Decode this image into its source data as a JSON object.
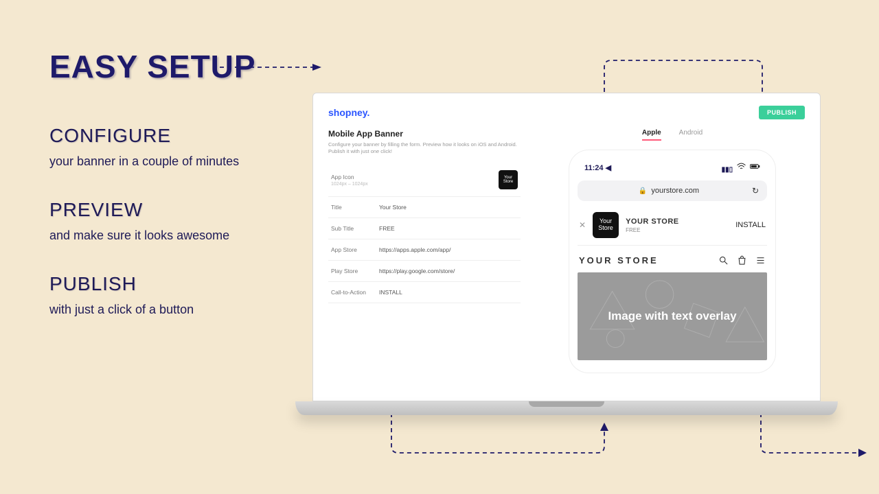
{
  "marketing": {
    "title": "EASY SETUP",
    "steps": [
      {
        "heading": "CONFIGURE",
        "desc": "your banner in a couple of minutes"
      },
      {
        "heading": "PREVIEW",
        "desc": "and make sure it looks awesome"
      },
      {
        "heading": "PUBLISH",
        "desc": "with just a click of a button"
      }
    ]
  },
  "app": {
    "brand": "shopney.",
    "publish_label": "PUBLISH",
    "config": {
      "title": "Mobile App Banner",
      "desc": "Configure your banner by filling the form. Preview how it looks on iOS and Android. Publish it with just one click!",
      "fields": {
        "app_icon": {
          "label": "App Icon",
          "helper": "1024px – 1024px",
          "value": "Your\nStore"
        },
        "title": {
          "label": "Title",
          "value": "Your Store"
        },
        "subtitle": {
          "label": "Sub Title",
          "value": "FREE"
        },
        "appstore": {
          "label": "App Store",
          "value": "https://apps.apple.com/app/"
        },
        "playstore": {
          "label": "Play Store",
          "value": "https://play.google.com/store/"
        },
        "cta": {
          "label": "Call-to-Action",
          "value": "INSTALL"
        }
      }
    },
    "preview": {
      "tabs": {
        "apple": "Apple",
        "android": "Android"
      },
      "phone": {
        "time": "11:24",
        "url": "yourstore.com",
        "banner_title": "YOUR STORE",
        "banner_sub": "FREE",
        "banner_cta": "INSTALL",
        "banner_icon": "Your\nStore",
        "store_name": "YOUR STORE",
        "hero_text": "Image with text overlay"
      }
    }
  }
}
